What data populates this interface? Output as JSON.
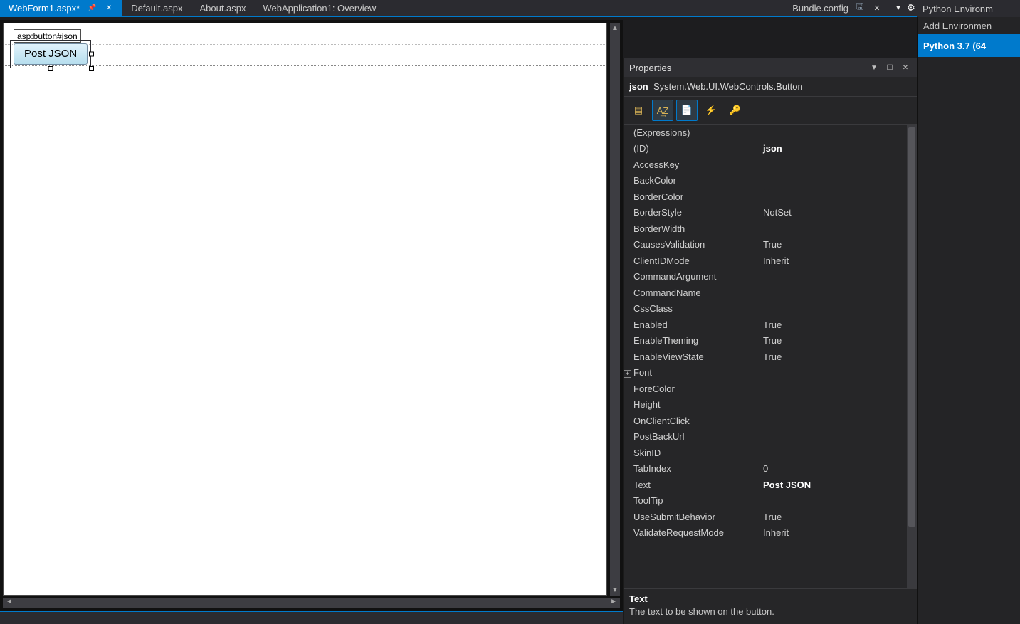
{
  "tabs": {
    "active": "WebForm1.aspx*",
    "others": [
      "Default.aspx",
      "About.aspx",
      "WebApplication1: Overview"
    ],
    "right": "Bundle.config"
  },
  "env": {
    "title": "Python Environm",
    "add": "Add Environmen",
    "selected": "Python 3.7 (64"
  },
  "designer": {
    "tag_chip": "asp:button#json",
    "button_text": "Post JSON"
  },
  "properties": {
    "title": "Properties",
    "object_id": "json",
    "object_type": "System.Web.UI.WebControls.Button",
    "rows": [
      {
        "name": "(Expressions)",
        "value": ""
      },
      {
        "name": "(ID)",
        "value": "json",
        "bold": true
      },
      {
        "name": "AccessKey",
        "value": ""
      },
      {
        "name": "BackColor",
        "value": ""
      },
      {
        "name": "BorderColor",
        "value": ""
      },
      {
        "name": "BorderStyle",
        "value": "NotSet"
      },
      {
        "name": "BorderWidth",
        "value": ""
      },
      {
        "name": "CausesValidation",
        "value": "True"
      },
      {
        "name": "ClientIDMode",
        "value": "Inherit"
      },
      {
        "name": "CommandArgument",
        "value": ""
      },
      {
        "name": "CommandName",
        "value": ""
      },
      {
        "name": "CssClass",
        "value": ""
      },
      {
        "name": "Enabled",
        "value": "True"
      },
      {
        "name": "EnableTheming",
        "value": "True"
      },
      {
        "name": "EnableViewState",
        "value": "True"
      },
      {
        "name": "Font",
        "value": "",
        "expandable": true
      },
      {
        "name": "ForeColor",
        "value": ""
      },
      {
        "name": "Height",
        "value": ""
      },
      {
        "name": "OnClientClick",
        "value": ""
      },
      {
        "name": "PostBackUrl",
        "value": ""
      },
      {
        "name": "SkinID",
        "value": ""
      },
      {
        "name": "TabIndex",
        "value": "0"
      },
      {
        "name": "Text",
        "value": "Post JSON",
        "bold": true
      },
      {
        "name": "ToolTip",
        "value": ""
      },
      {
        "name": "UseSubmitBehavior",
        "value": "True"
      },
      {
        "name": "ValidateRequestMode",
        "value": "Inherit"
      }
    ],
    "description": {
      "name": "Text",
      "text": "The text to be shown on the button."
    }
  }
}
